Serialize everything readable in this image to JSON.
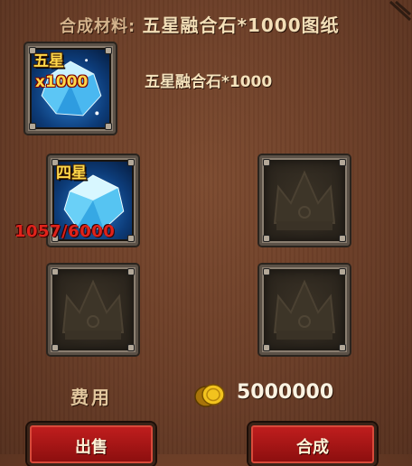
{
  "header": {
    "label": "合成材料:",
    "value": "五星融合石*1000图纸"
  },
  "target": {
    "badge": "五星",
    "qty": "x1000",
    "name": "五星融合石*1000",
    "icon": "diamond-gem-icon"
  },
  "material": {
    "badge": "四星",
    "progress": "1057/6000",
    "icon": "diamond-gem-icon"
  },
  "empty_slot_icon": "crown-icon",
  "cost": {
    "label": "费用",
    "value": "5000000",
    "icon": "gold-coin-icon"
  },
  "buttons": {
    "sell": "出售",
    "synth": "合成"
  },
  "colors": {
    "progress_red": "#e0231b",
    "badge_yellow": "#ffd84a",
    "button_red": "#c21e1e"
  }
}
